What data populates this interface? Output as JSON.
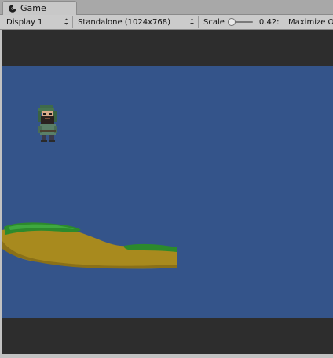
{
  "window": {
    "tab_title": "Game",
    "tab_icon": "unity-game-icon"
  },
  "toolbar": {
    "display": "Display 1",
    "resolution": "Standalone (1024x768)",
    "scale_label": "Scale",
    "scale_value": "0.42:",
    "scale_level": 0.0,
    "maximize": "Maximize O"
  },
  "scene": {
    "sky_color": "#34548a",
    "letterbox_color": "#2d2d2d",
    "grass_color": "#2c8a2c",
    "ground_color": "#a88a1e"
  }
}
